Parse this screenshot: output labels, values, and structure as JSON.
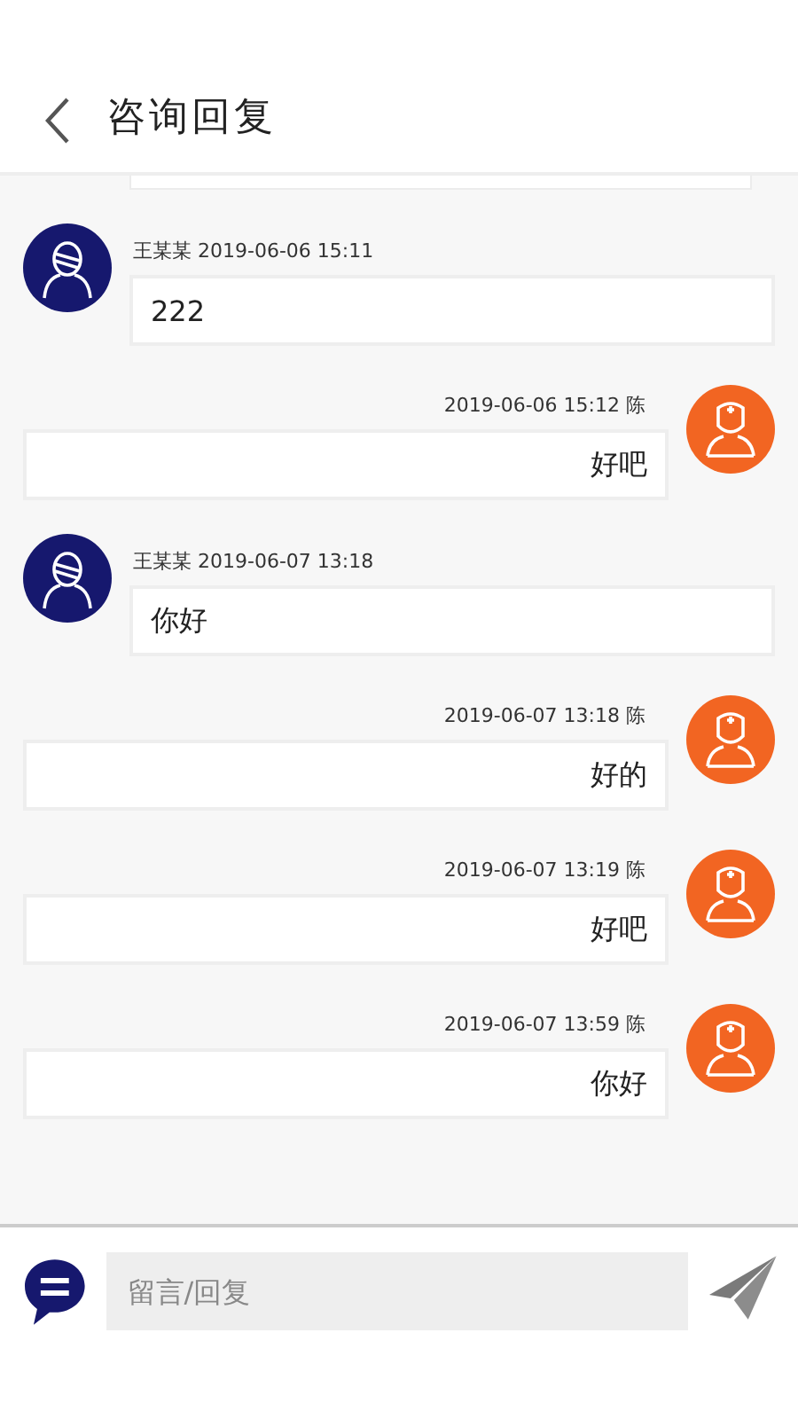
{
  "header": {
    "title": "咨询回复"
  },
  "messages": [
    {
      "kind": "user",
      "meta": "王某某 2019-06-06 15:11",
      "text": "222"
    },
    {
      "kind": "staff",
      "meta": "2019-06-06 15:12 陈",
      "text": "好吧"
    },
    {
      "kind": "user",
      "meta": "王某某 2019-06-07 13:18",
      "text": "你好"
    },
    {
      "kind": "staff",
      "meta": "2019-06-07 13:18 陈",
      "text": "好的"
    },
    {
      "kind": "staff",
      "meta": "2019-06-07 13:19 陈",
      "text": "好吧"
    },
    {
      "kind": "staff",
      "meta": "2019-06-07 13:59 陈",
      "text": "你好"
    }
  ],
  "composer": {
    "placeholder": "留言/回复"
  }
}
